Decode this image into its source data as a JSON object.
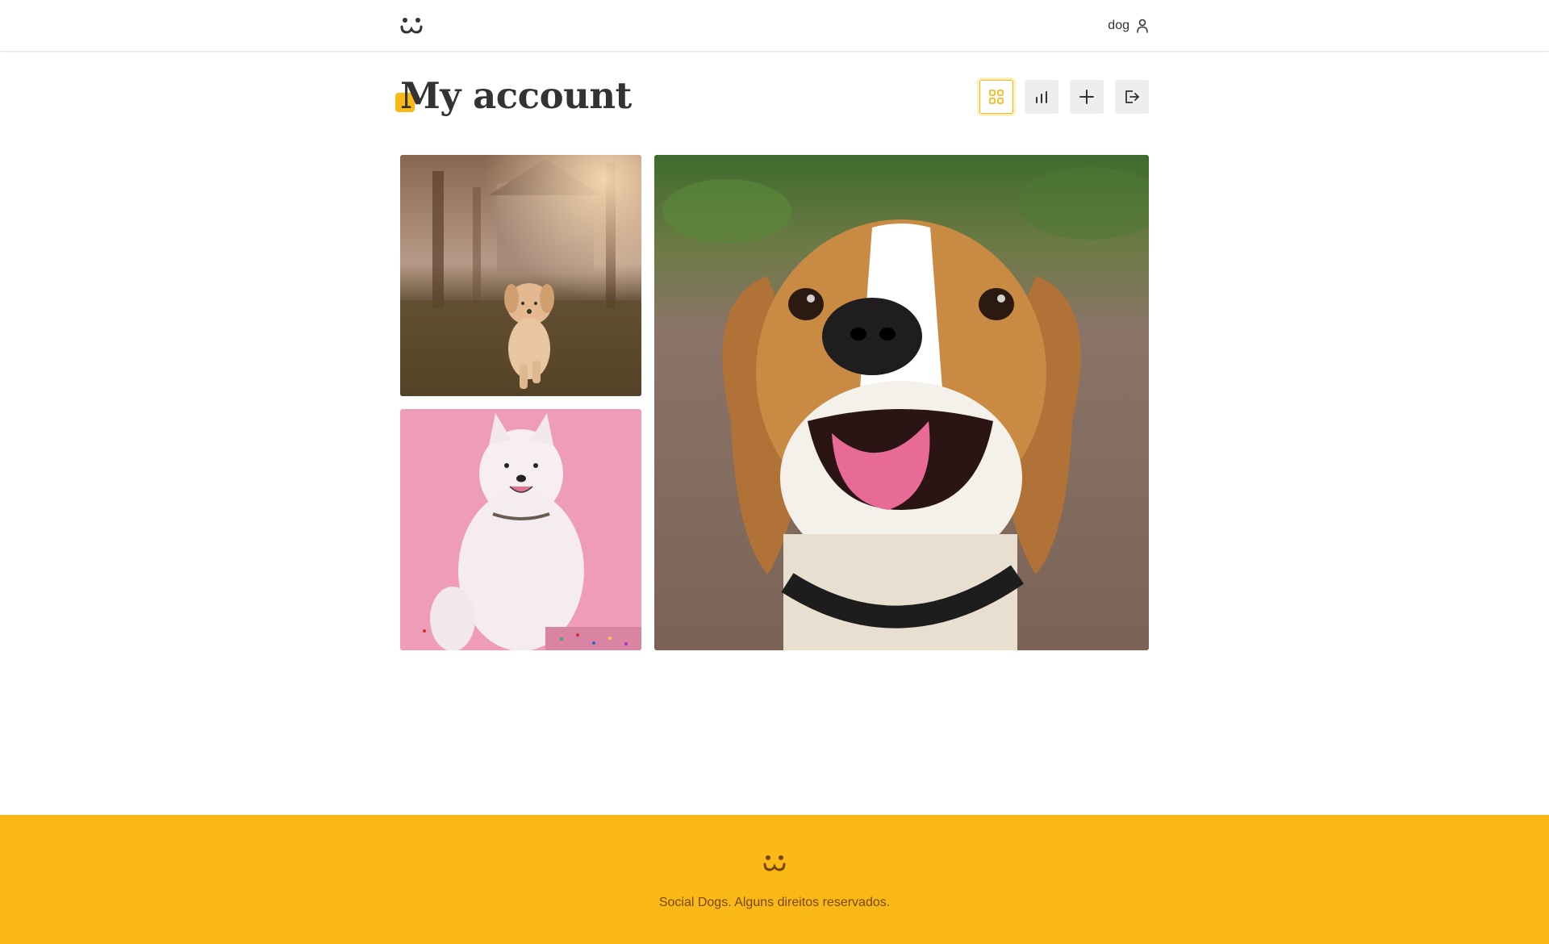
{
  "app": {
    "name": "Social Dogs"
  },
  "header": {
    "logo_icon": "dog-face-logo-icon",
    "user": {
      "username": "dog",
      "icon": "person-icon"
    }
  },
  "page": {
    "title": "My account"
  },
  "toolbar": {
    "buttons": [
      {
        "icon": "grid-icon",
        "active": true
      },
      {
        "icon": "bar-chart-icon",
        "active": false
      },
      {
        "icon": "plus-icon",
        "active": false
      },
      {
        "icon": "logout-icon",
        "active": false
      }
    ]
  },
  "feed": {
    "photos": [
      {
        "subject": "golden retriever puppy running on grass"
      },
      {
        "subject": "white fluffy samoyed on pink background"
      },
      {
        "subject": "smiling beagle close-up"
      }
    ]
  },
  "footer": {
    "logo_icon": "dog-face-logo-icon",
    "text": "Social Dogs. Alguns direitos reservados."
  },
  "colors": {
    "brand": "#fbb917",
    "footer_text": "#764701",
    "text": "#333333"
  }
}
